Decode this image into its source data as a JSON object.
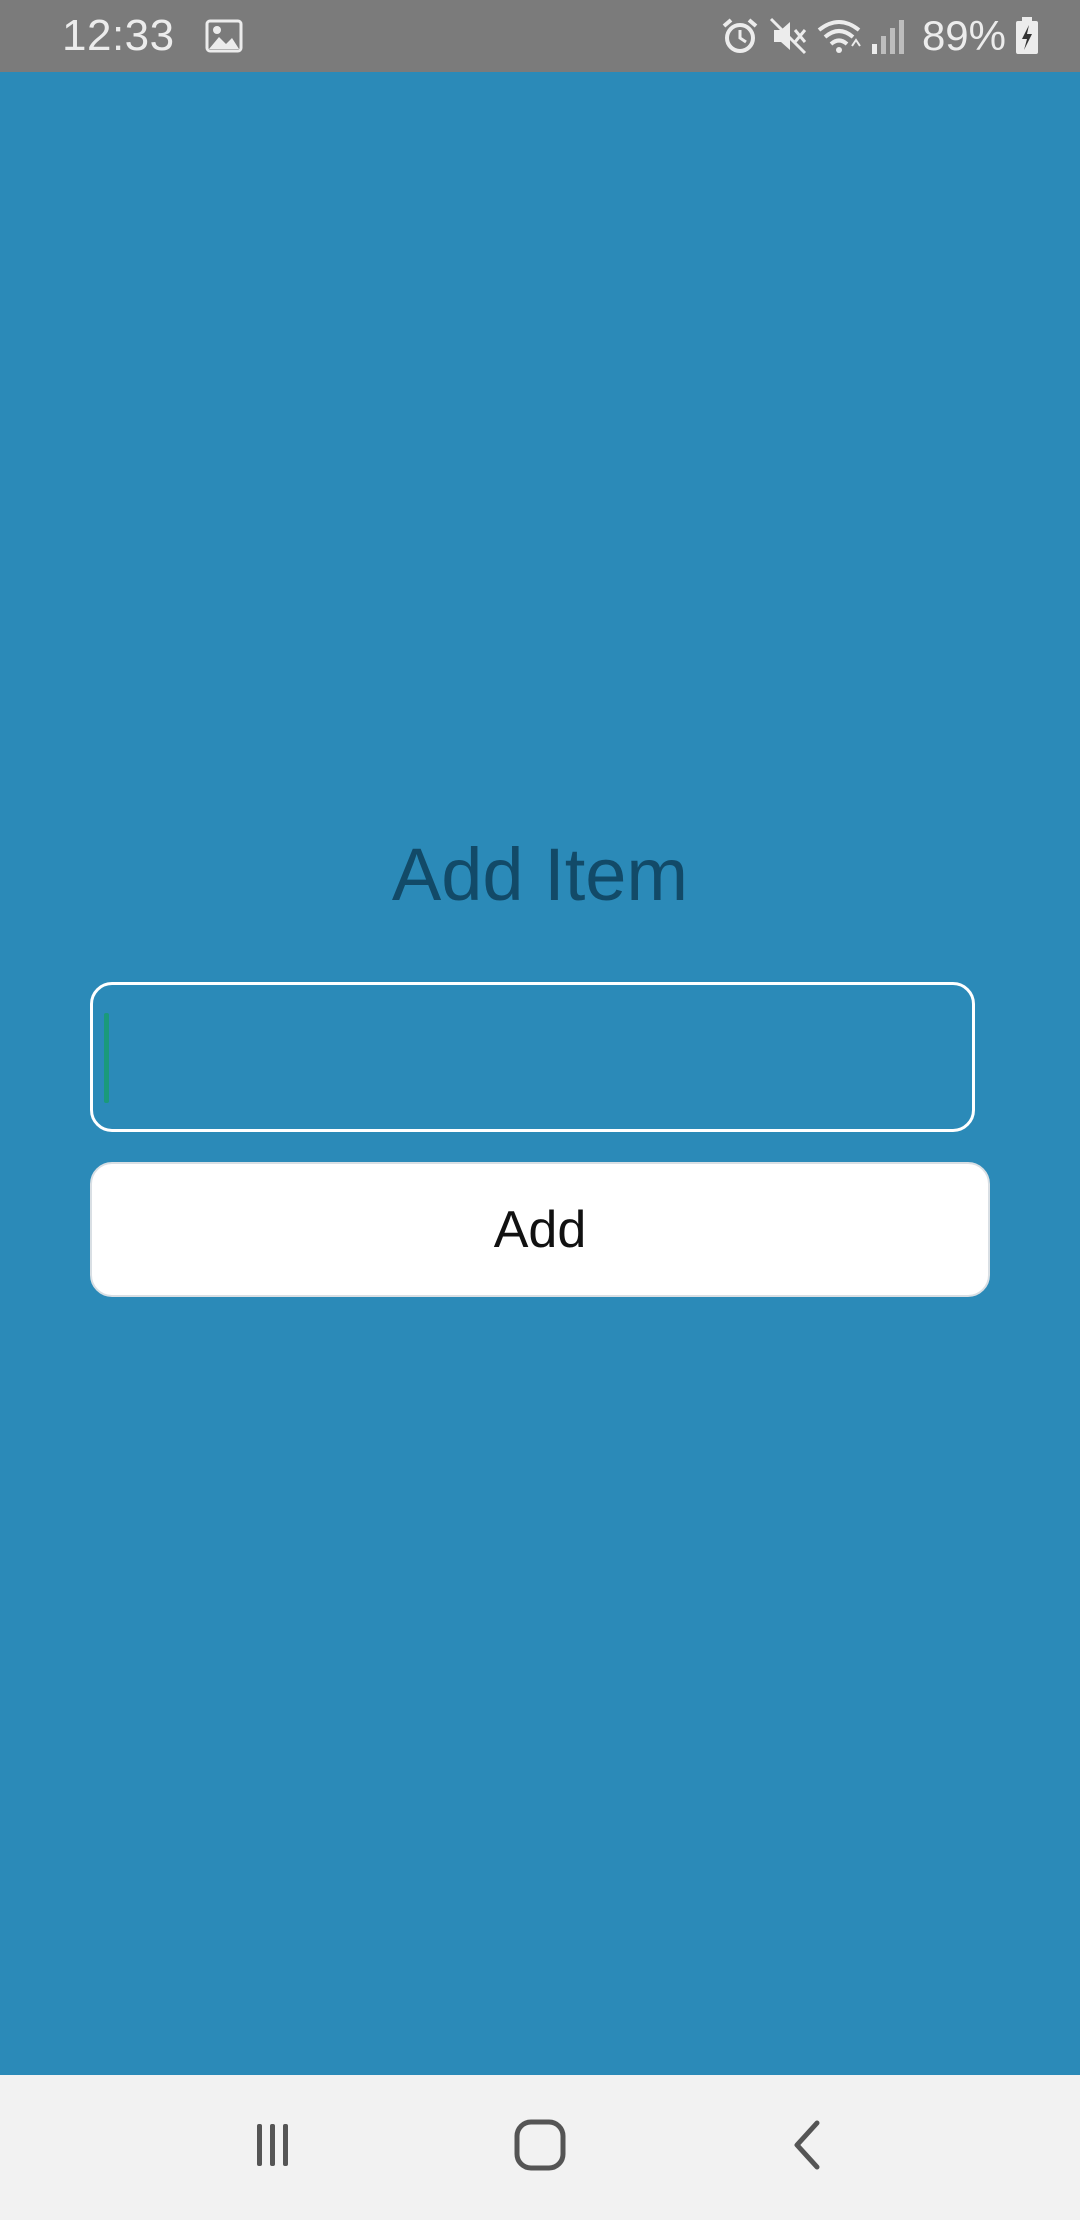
{
  "status_bar": {
    "time": "12:33",
    "battery_percent": "89%",
    "icons": [
      "image-icon",
      "alarm-icon",
      "mute-icon",
      "wifi-icon",
      "signal-icon",
      "battery-charging-icon"
    ]
  },
  "main": {
    "title": "Add Item",
    "input": {
      "value": "",
      "placeholder": ""
    },
    "add_button_label": "Add"
  },
  "nav_bar": {
    "buttons": [
      "recent-apps-icon",
      "home-icon",
      "back-icon"
    ]
  },
  "colors": {
    "background": "#2b8ab8",
    "title": "#124a68",
    "status_bar": "#7b7b7b",
    "nav_bar": "#f2f2f2",
    "cursor": "#1a9a7a"
  }
}
